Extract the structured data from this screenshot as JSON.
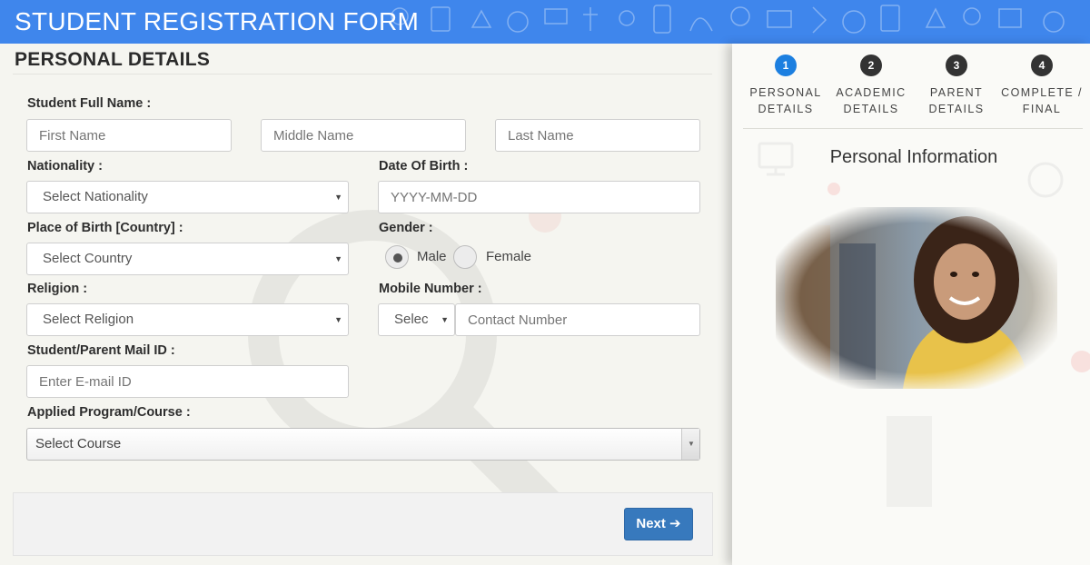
{
  "header": {
    "title": "STUDENT REGISTRATION FORM"
  },
  "section": {
    "title": "PERSONAL DETAILS"
  },
  "form": {
    "full_name_label": "Student Full Name :",
    "first_name_placeholder": "First Name",
    "middle_name_placeholder": "Middle Name",
    "last_name_placeholder": "Last Name",
    "nationality_label": "Nationality :",
    "nationality_value": "Select Nationality",
    "dob_label": "Date Of Birth :",
    "dob_placeholder": "YYYY-MM-DD",
    "pob_label": "Place of Birth [Country] :",
    "pob_value": "Select Country",
    "gender_label": "Gender :",
    "gender_options": [
      "Male",
      "Female"
    ],
    "gender_selected": "Male",
    "religion_label": "Religion :",
    "religion_value": "Select Religion",
    "mobile_label": "Mobile Number :",
    "mobile_code_value": "Selec",
    "mobile_placeholder": "Contact Number",
    "mail_label": "Student/Parent Mail ID :",
    "mail_placeholder": "Enter E-mail ID",
    "course_label": "Applied Program/Course :",
    "course_value": "Select Course"
  },
  "footer": {
    "next_label": "Next"
  },
  "steps": [
    {
      "number": "1",
      "line1": "PERSONAL",
      "line2": "DETAILS",
      "active": true
    },
    {
      "number": "2",
      "line1": "ACADEMIC",
      "line2": "DETAILS",
      "active": false
    },
    {
      "number": "3",
      "line1": "PARENT",
      "line2": "DETAILS",
      "active": false
    },
    {
      "number": "4",
      "line1": "COMPLETE /",
      "line2": "FINAL",
      "active": false
    }
  ],
  "side": {
    "title": "Personal Information"
  },
  "colors": {
    "header": "#3f86ec",
    "active_step": "#1c7fe0",
    "next_button": "#3779bd"
  },
  "icons": [
    "arrow-right-icon",
    "chevron-down-icon",
    "student-photo"
  ]
}
